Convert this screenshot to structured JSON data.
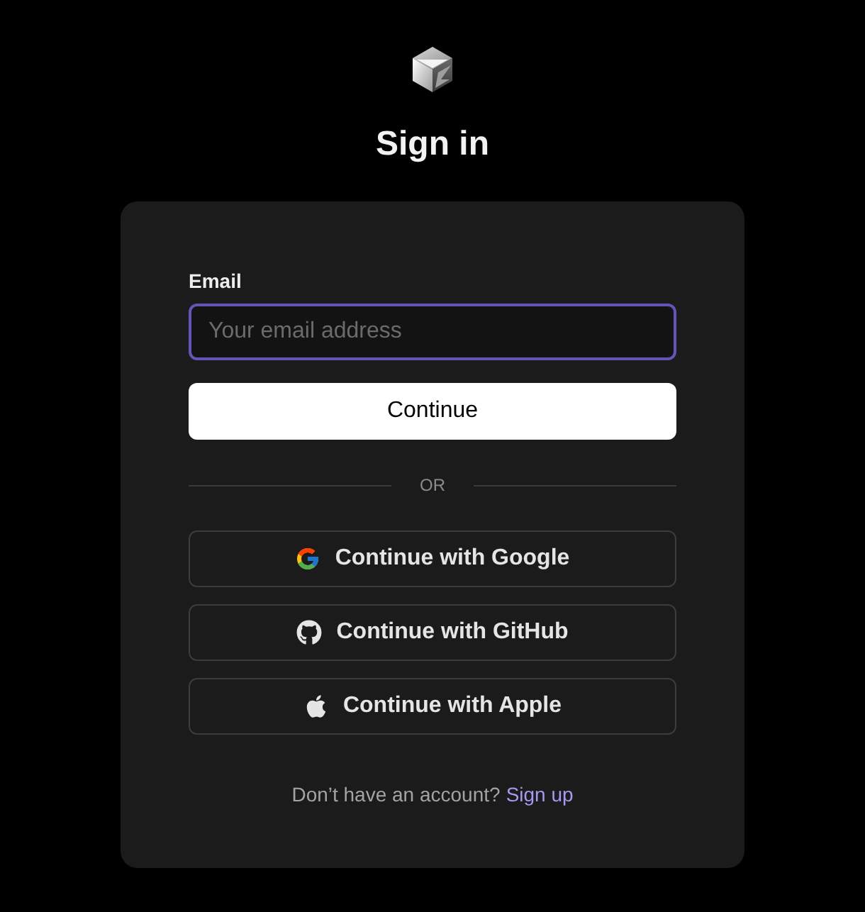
{
  "title": "Sign in",
  "email": {
    "label": "Email",
    "placeholder": "Your email address",
    "focused": true
  },
  "continue_button": "Continue",
  "divider": "OR",
  "providers": [
    {
      "kind": "google",
      "label": "Continue with Google"
    },
    {
      "kind": "github",
      "label": "Continue with GitHub"
    },
    {
      "kind": "apple",
      "label": "Continue with Apple"
    }
  ],
  "footer": {
    "text": "Don’t have an account?",
    "link": "Sign up"
  }
}
